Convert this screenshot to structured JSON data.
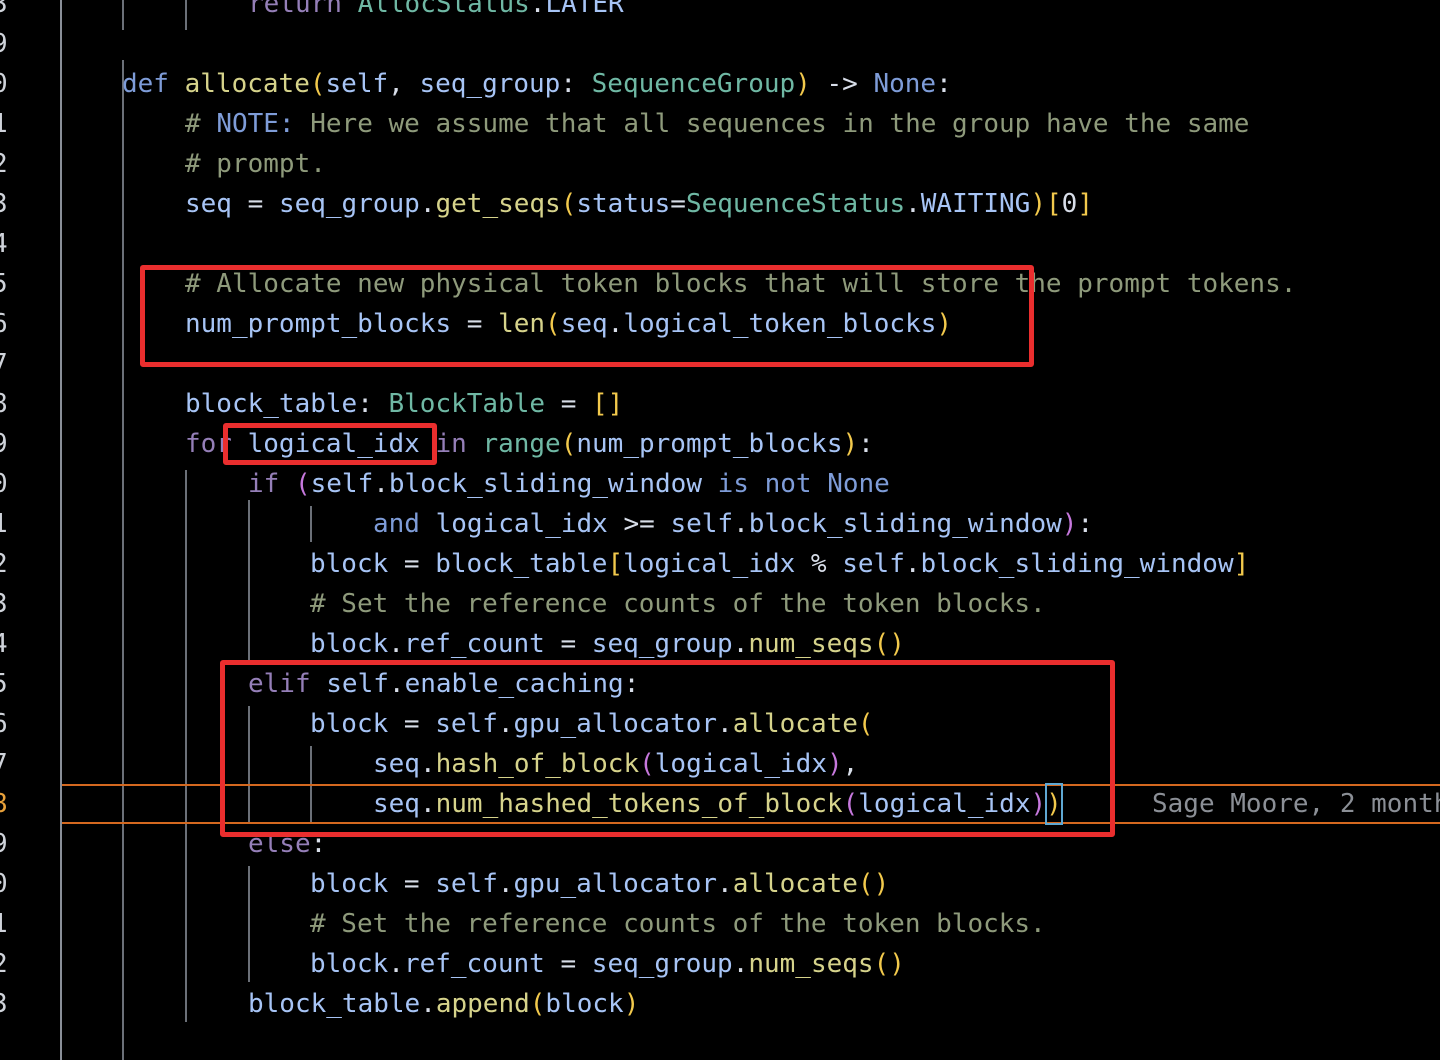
{
  "editor": {
    "current_line": "7",
    "gutter": [
      "3",
      "9",
      "0",
      "1",
      "2",
      "3",
      "4",
      "5",
      "6",
      "7",
      "8",
      "9",
      "0",
      "1",
      "2",
      "3",
      "4",
      "5",
      "6",
      "7",
      "8",
      "9",
      "0",
      "1",
      "2",
      "3"
    ],
    "blame": "Sage Moore, 2 month",
    "colors": {
      "background": "#000000",
      "annotation_box": "#ea2e2e",
      "current_line_border": "#d4681f",
      "keyword": "#7e9cd8",
      "function": "#d6d38b",
      "class": "#6fb8a4",
      "variable": "#a7c4f5",
      "comment": "#8e9a7b"
    },
    "code": [
      {
        "tokens": [
          [
            "kw2",
            "return"
          ],
          [
            "txt",
            " "
          ],
          [
            "cls",
            "AllocStatus"
          ],
          [
            "txt",
            "."
          ],
          [
            "var",
            "LATER"
          ]
        ]
      },
      {
        "tokens": []
      },
      {
        "tokens": [
          [
            "kw",
            "def"
          ],
          [
            "txt",
            " "
          ],
          [
            "fn",
            "allocate"
          ],
          [
            "br",
            "("
          ],
          [
            "var",
            "self"
          ],
          [
            "txt",
            ", "
          ],
          [
            "var",
            "seq_group"
          ],
          [
            "txt",
            ": "
          ],
          [
            "cls",
            "SequenceGroup"
          ],
          [
            "br",
            ")"
          ],
          [
            "txt",
            " -> "
          ],
          [
            "kw",
            "None"
          ],
          [
            "txt",
            ":"
          ]
        ]
      },
      {
        "tokens": [
          [
            "cmt",
            "# "
          ],
          [
            "kw",
            "NOTE:"
          ],
          [
            "cmt",
            " Here we assume that all sequences in the group have the same"
          ]
        ]
      },
      {
        "tokens": [
          [
            "cmt",
            "# prompt."
          ]
        ]
      },
      {
        "tokens": [
          [
            "var",
            "seq"
          ],
          [
            "txt",
            " = "
          ],
          [
            "var",
            "seq_group"
          ],
          [
            "txt",
            "."
          ],
          [
            "fn",
            "get_seqs"
          ],
          [
            "br",
            "("
          ],
          [
            "var",
            "status"
          ],
          [
            "txt",
            "="
          ],
          [
            "cls",
            "SequenceStatus"
          ],
          [
            "txt",
            "."
          ],
          [
            "var",
            "WAITING"
          ],
          [
            "br",
            ")"
          ],
          [
            "br",
            "["
          ],
          [
            "num",
            "0"
          ],
          [
            "br",
            "]"
          ]
        ]
      },
      {
        "tokens": []
      },
      {
        "tokens": [
          [
            "cmt",
            "# Allocate new physical token blocks that will store the prompt tokens."
          ]
        ]
      },
      {
        "tokens": [
          [
            "var",
            "num_prompt_blocks"
          ],
          [
            "txt",
            " = "
          ],
          [
            "fn",
            "len"
          ],
          [
            "br",
            "("
          ],
          [
            "var",
            "seq"
          ],
          [
            "txt",
            "."
          ],
          [
            "var",
            "logical_token_blocks"
          ],
          [
            "br",
            ")"
          ]
        ]
      },
      {
        "tokens": []
      },
      {
        "tokens": [
          [
            "var",
            "block_table"
          ],
          [
            "txt",
            ": "
          ],
          [
            "cls",
            "BlockTable"
          ],
          [
            "txt",
            " = "
          ],
          [
            "br",
            "[]"
          ]
        ]
      },
      {
        "tokens": [
          [
            "kw2",
            "for"
          ],
          [
            "txt",
            " "
          ],
          [
            "var",
            "logical_idx"
          ],
          [
            "txt",
            " "
          ],
          [
            "kw2",
            "in"
          ],
          [
            "txt",
            " "
          ],
          [
            "cls",
            "range"
          ],
          [
            "br",
            "("
          ],
          [
            "var",
            "num_prompt_blocks"
          ],
          [
            "br",
            ")"
          ],
          [
            "txt",
            ":"
          ]
        ]
      },
      {
        "tokens": [
          [
            "kw2",
            "if"
          ],
          [
            "txt",
            " "
          ],
          [
            "brp",
            "("
          ],
          [
            "var",
            "self"
          ],
          [
            "txt",
            "."
          ],
          [
            "var",
            "block_sliding_window"
          ],
          [
            "txt",
            " "
          ],
          [
            "kw",
            "is not None"
          ]
        ]
      },
      {
        "tokens": [
          [
            "kw",
            "and"
          ],
          [
            "txt",
            " "
          ],
          [
            "var",
            "logical_idx"
          ],
          [
            "txt",
            " >= "
          ],
          [
            "var",
            "self"
          ],
          [
            "txt",
            "."
          ],
          [
            "var",
            "block_sliding_window"
          ],
          [
            "brp",
            ")"
          ],
          [
            "txt",
            ":"
          ]
        ]
      },
      {
        "tokens": [
          [
            "var",
            "block"
          ],
          [
            "txt",
            " = "
          ],
          [
            "var",
            "block_table"
          ],
          [
            "br",
            "["
          ],
          [
            "var",
            "logical_idx"
          ],
          [
            "txt",
            " % "
          ],
          [
            "var",
            "self"
          ],
          [
            "txt",
            "."
          ],
          [
            "var",
            "block_sliding_window"
          ],
          [
            "br",
            "]"
          ]
        ]
      },
      {
        "tokens": [
          [
            "cmt",
            "# Set the reference counts of the token blocks."
          ]
        ]
      },
      {
        "tokens": [
          [
            "var",
            "block"
          ],
          [
            "txt",
            "."
          ],
          [
            "var",
            "ref_count"
          ],
          [
            "txt",
            " = "
          ],
          [
            "var",
            "seq_group"
          ],
          [
            "txt",
            "."
          ],
          [
            "fn",
            "num_seqs"
          ],
          [
            "br",
            "()"
          ]
        ]
      },
      {
        "tokens": [
          [
            "kw2",
            "elif"
          ],
          [
            "txt",
            " "
          ],
          [
            "var",
            "self"
          ],
          [
            "txt",
            "."
          ],
          [
            "var",
            "enable_caching"
          ],
          [
            "txt",
            ":"
          ]
        ]
      },
      {
        "tokens": [
          [
            "var",
            "block"
          ],
          [
            "txt",
            " = "
          ],
          [
            "var",
            "self"
          ],
          [
            "txt",
            "."
          ],
          [
            "var",
            "gpu_allocator"
          ],
          [
            "txt",
            "."
          ],
          [
            "fn",
            "allocate"
          ],
          [
            "br",
            "("
          ]
        ]
      },
      {
        "tokens": [
          [
            "var",
            "seq"
          ],
          [
            "txt",
            "."
          ],
          [
            "fn",
            "hash_of_block"
          ],
          [
            "brp",
            "("
          ],
          [
            "var",
            "logical_idx"
          ],
          [
            "brp",
            ")"
          ],
          [
            "txt",
            ","
          ]
        ]
      },
      {
        "tokens": [
          [
            "var",
            "seq"
          ],
          [
            "txt",
            "."
          ],
          [
            "fn",
            "num_hashed_tokens_of_block"
          ],
          [
            "brp",
            "("
          ],
          [
            "var",
            "logical_idx"
          ],
          [
            "brp",
            ")"
          ],
          [
            "br",
            ")"
          ]
        ]
      },
      {
        "tokens": [
          [
            "kw2",
            "else"
          ],
          [
            "txt",
            ":"
          ]
        ]
      },
      {
        "tokens": [
          [
            "var",
            "block"
          ],
          [
            "txt",
            " = "
          ],
          [
            "var",
            "self"
          ],
          [
            "txt",
            "."
          ],
          [
            "var",
            "gpu_allocator"
          ],
          [
            "txt",
            "."
          ],
          [
            "fn",
            "allocate"
          ],
          [
            "br",
            "()"
          ]
        ]
      },
      {
        "tokens": [
          [
            "cmt",
            "# Set the reference counts of the token blocks."
          ]
        ]
      },
      {
        "tokens": [
          [
            "var",
            "block"
          ],
          [
            "txt",
            "."
          ],
          [
            "var",
            "ref_count"
          ],
          [
            "txt",
            " = "
          ],
          [
            "var",
            "seq_group"
          ],
          [
            "txt",
            "."
          ],
          [
            "fn",
            "num_seqs"
          ],
          [
            "br",
            "()"
          ]
        ]
      },
      {
        "tokens": [
          [
            "var",
            "block_table"
          ],
          [
            "txt",
            "."
          ],
          [
            "fn",
            "append"
          ],
          [
            "br",
            "("
          ],
          [
            "var",
            "block"
          ],
          [
            "br",
            ")"
          ]
        ]
      }
    ]
  }
}
